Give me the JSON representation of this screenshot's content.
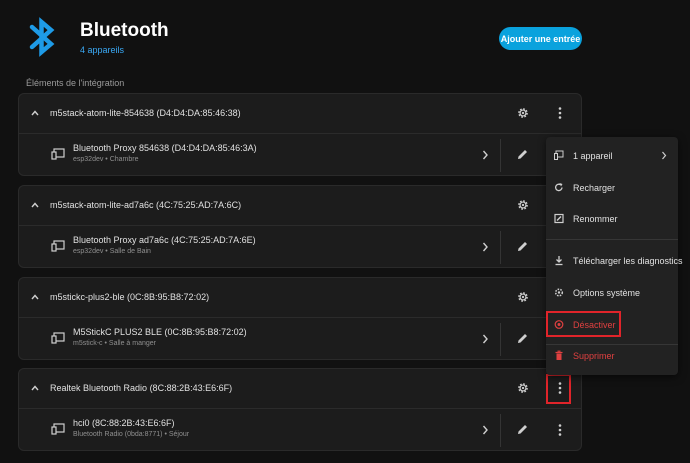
{
  "header": {
    "title": "Bluetooth",
    "subtitle": "4 appareils",
    "add_button": "Ajouter une entrée",
    "logo_icon": "bluetooth-icon",
    "brand_color": "#1e9be7"
  },
  "section_title": "Éléments de l'intégration",
  "cards": [
    {
      "title": "m5stack-atom-lite-854638 (D4:D4:DA:85:46:38)",
      "entry": {
        "name": "Bluetooth Proxy 854638 (D4:D4:DA:85:46:3A)",
        "sub": "esp32dev • Chambre"
      }
    },
    {
      "title": "m5stack-atom-lite-ad7a6c (4C:75:25:AD:7A:6C)",
      "entry": {
        "name": "Bluetooth Proxy ad7a6c (4C:75:25:AD:7A:6E)",
        "sub": "esp32dev • Salle de Bain"
      }
    },
    {
      "title": "m5stickc-plus2-ble (0C:8B:95:B8:72:02)",
      "entry": {
        "name": "M5StickC PLUS2 BLE (0C:8B:95:B8:72:02)",
        "sub": "m5stick-c • Salle à manger"
      }
    },
    {
      "title": "Realtek Bluetooth Radio (8C:88:2B:43:E6:6F)",
      "entry": {
        "name": "hci0 (8C:88:2B:43:E6:6F)",
        "sub": "Bluetooth Radio (0bda:8771) • Séjour"
      }
    }
  ],
  "menu": {
    "items": [
      {
        "label": "1 appareil",
        "icon": "device-icon"
      },
      {
        "label": "Recharger",
        "icon": "reload-icon"
      },
      {
        "label": "Renommer",
        "icon": "rename-icon"
      },
      {
        "label": "Télécharger les diagnostics",
        "icon": "download-icon"
      },
      {
        "label": "Options système",
        "icon": "gear-icon"
      },
      {
        "label": "Désactiver",
        "icon": "disable-icon"
      },
      {
        "label": "Supprimer",
        "icon": "trash-icon"
      }
    ],
    "danger_color": "#e04040",
    "highlight_color": "#e0242a"
  }
}
